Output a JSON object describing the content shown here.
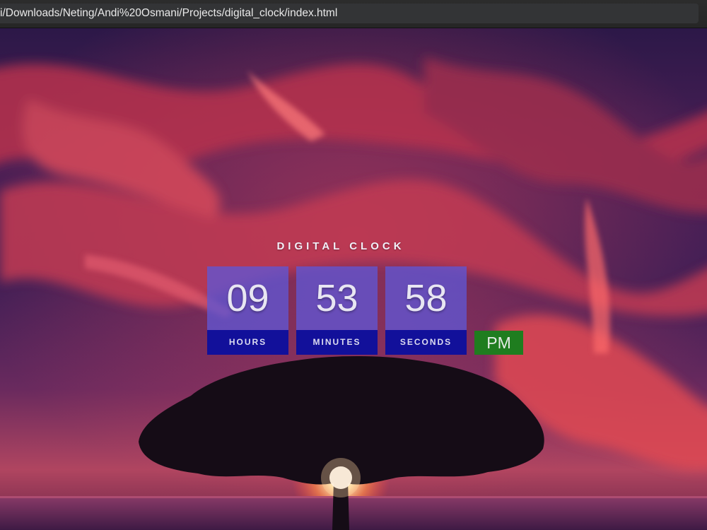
{
  "browser": {
    "url": "i/Downloads/Neting/Andi%20Osmani/Projects/digital_clock/index.html"
  },
  "clock": {
    "title": "DIGITAL CLOCK",
    "hours": "09",
    "hours_label": "HOURS",
    "minutes": "53",
    "minutes_label": "MINUTES",
    "seconds": "58",
    "seconds_label": "SECONDS",
    "period": "PM"
  },
  "colors": {
    "digit_box": "#6056d4",
    "label_box": "#12109a",
    "period_box": "#1f7d1f"
  }
}
